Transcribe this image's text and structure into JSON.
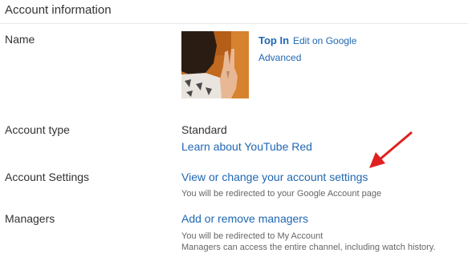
{
  "section": {
    "title": "Account information"
  },
  "name_row": {
    "label": "Name",
    "channel_name": "Top In",
    "edit_link": "Edit on Google",
    "advanced_link": "Advanced"
  },
  "account_type_row": {
    "label": "Account type",
    "value": "Standard",
    "learn_link": "Learn about YouTube Red"
  },
  "account_settings_row": {
    "label": "Account Settings",
    "link": "View or change your account settings",
    "help": "You will be redirected to your Google Account page"
  },
  "managers_row": {
    "label": "Managers",
    "link": "Add or remove managers",
    "help_line1": "You will be redirected to My Account",
    "help_line2": "Managers can access the entire channel, including watch history."
  },
  "colors": {
    "link": "#1f67b3",
    "annotation_arrow": "#e02020"
  }
}
